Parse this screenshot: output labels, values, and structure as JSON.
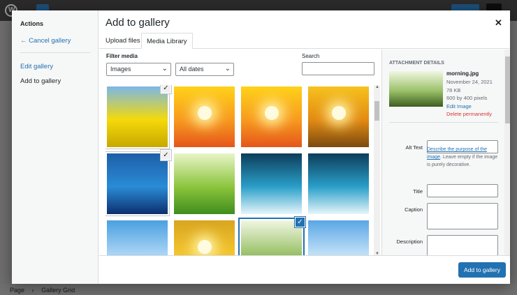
{
  "editor": {
    "breadcrumb_page": "Page",
    "breadcrumb_sep": "›",
    "breadcrumb_block": "Gallery Grid"
  },
  "modal": {
    "title": "Add to gallery",
    "close_icon": "close-icon",
    "menu": {
      "heading": "Actions",
      "cancel_label": "← Cancel gallery",
      "edit_label": "Edit gallery",
      "add_label": "Add to gallery"
    },
    "tabs": [
      {
        "label": "Upload files",
        "active": false
      },
      {
        "label": "Media Library",
        "active": true
      }
    ],
    "filter": {
      "label": "Filter media",
      "type_value": "Images",
      "date_value": "All dates",
      "search_label": "Search",
      "search_value": ""
    },
    "attachments": [
      {
        "name": "yellow-rapeseed-field",
        "state": "selected",
        "colors": [
          "#7ab8e8",
          "#f5d90a",
          "#c7a800"
        ]
      },
      {
        "name": "orange-sunburst-1",
        "state": "none",
        "colors": [
          "#ffd21a",
          "#f79a1e",
          "#e5561b"
        ]
      },
      {
        "name": "orange-sunburst-2",
        "state": "none",
        "colors": [
          "#ffd21a",
          "#f79a1e",
          "#e5561b"
        ]
      },
      {
        "name": "sunset-clouds",
        "state": "none",
        "colors": [
          "#f6c21e",
          "#e38a12",
          "#7a4b10"
        ]
      },
      {
        "name": "blue-jellyfish",
        "state": "selected",
        "colors": [
          "#1d5fa8",
          "#2a8bd6",
          "#0c2f6e"
        ]
      },
      {
        "name": "green-grass",
        "state": "none",
        "colors": [
          "#e8f5c7",
          "#8cc53d",
          "#3f8d1d"
        ]
      },
      {
        "name": "ocean-wave-1",
        "state": "none",
        "colors": [
          "#0c3d5a",
          "#2a9fc9",
          "#e6f5fa"
        ]
      },
      {
        "name": "ocean-wave-2",
        "state": "none",
        "colors": [
          "#0c3d5a",
          "#2a9fc9",
          "#e6f5fa"
        ]
      },
      {
        "name": "blue-sky-sea",
        "state": "none",
        "colors": [
          "#4aa0e0",
          "#a9d4f5",
          "#2b7bc0"
        ]
      },
      {
        "name": "sunflower-field",
        "state": "none",
        "colors": [
          "#d9a520",
          "#f3c52e",
          "#7a5a0e"
        ]
      },
      {
        "name": "morning-forest",
        "state": "details",
        "colors": [
          "#f1f6e2",
          "#9bc26a",
          "#3e5e1f"
        ]
      },
      {
        "name": "sky-horizon",
        "state": "none",
        "colors": [
          "#5aa6e6",
          "#bfe0f7",
          "#3a88c9"
        ]
      }
    ],
    "details": {
      "heading": "Attachment Details",
      "filename": "morning.jpg",
      "date": "November 24, 2021",
      "size": "78 KB",
      "dimensions": "600 by 400 pixels",
      "edit_label": "Edit Image",
      "delete_label": "Delete permanently",
      "alt_label": "Alt Text",
      "alt_help_link": "Describe the purpose of the image",
      "alt_help_text": ". Leave empty if the image is purely decorative.",
      "title_label": "Title",
      "caption_label": "Caption",
      "description_label": "Description"
    },
    "primary_button": "Add to gallery"
  }
}
